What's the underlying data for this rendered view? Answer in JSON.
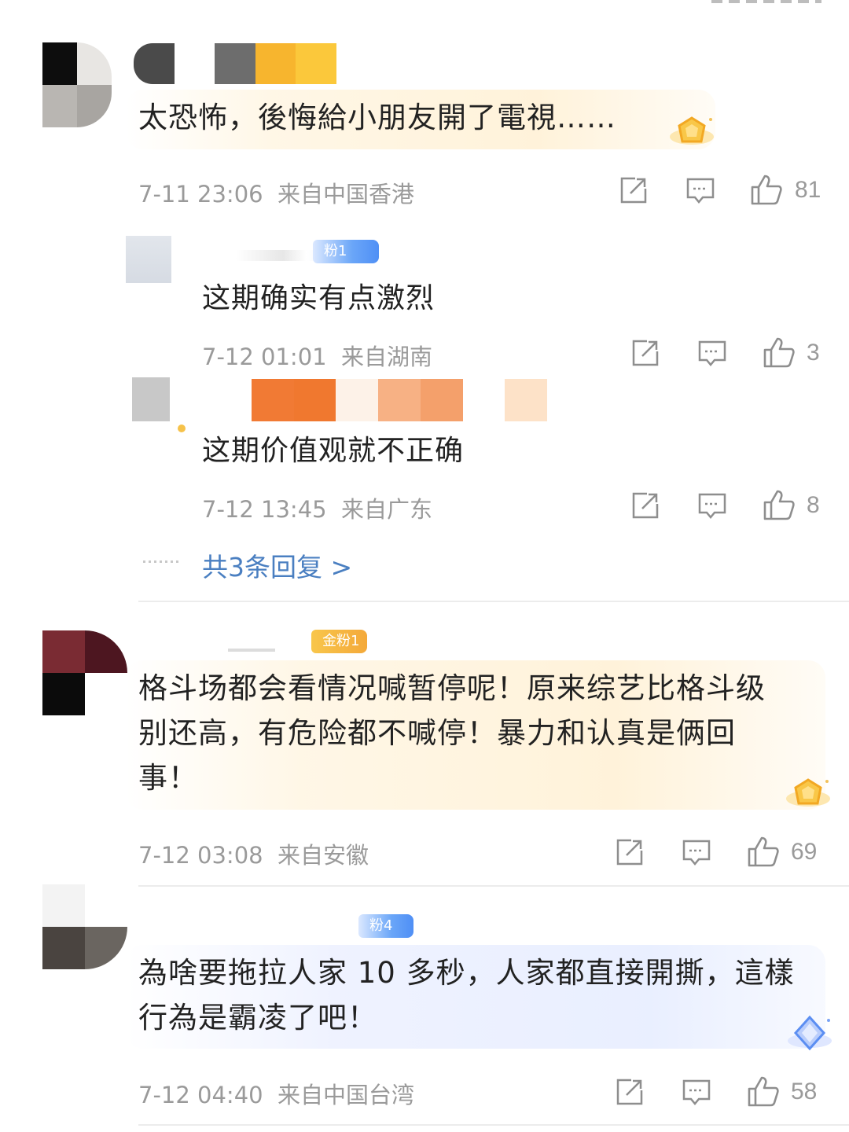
{
  "comments": [
    {
      "text": "太恐怖，後悔給小朋友開了電視……",
      "time": "7-11 23:06",
      "location": "来自中国香港",
      "likes": "81",
      "level_badge": "gold-diamond-badge",
      "replies": [
        {
          "text": "这期确实有点激烈",
          "time": "7-12 01:01",
          "location": "来自湖南",
          "likes": "3",
          "badge": "粉1"
        },
        {
          "text": "这期价值观就不正确",
          "time": "7-12 13:45",
          "location": "来自广东",
          "likes": "8"
        }
      ],
      "more_replies_label": "共3条回复 >"
    },
    {
      "badge": "金粉1",
      "text_lines": [
        "格斗场都会看情况喊暂停呢！原来综艺比格斗级",
        "别还高，有危险都不喊停！暴力和认真是俩回",
        "事！"
      ],
      "time": "7-12 03:08",
      "location": "来自安徽",
      "likes": "69",
      "level_badge": "gold-diamond-badge"
    },
    {
      "badge": "粉4",
      "text_lines": [
        "為啥要拖拉人家 10 多秒，人家都直接開撕，這樣",
        "行為是霸凌了吧！"
      ],
      "time": "7-12 04:40",
      "location": "来自中国台湾",
      "likes": "58",
      "level_badge": "blue-diamond-badge"
    }
  ],
  "colors": {
    "meta_gray": "#9a9a9a",
    "link_blue": "#4a7fc1",
    "gold_badge": "#f4a93a",
    "blue_badge": "#4f8ff5"
  }
}
